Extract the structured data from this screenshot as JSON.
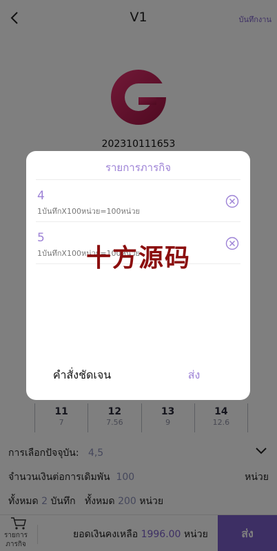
{
  "header": {
    "title": "V1",
    "history_label": "บันทึกงาน"
  },
  "profile": {
    "user_id": "202310111653"
  },
  "numbers": [
    {
      "main": "11",
      "sub": "7"
    },
    {
      "main": "12",
      "sub": "7.56"
    },
    {
      "main": "13",
      "sub": "9"
    },
    {
      "main": "14",
      "sub": "12.6"
    }
  ],
  "info": {
    "current_selection_label": "การเลือกปัจจุบัน:",
    "current_selection_value": "4,5",
    "amount_label": "จำนวนเงินต่อการเดิมพัน",
    "amount_value": "100",
    "amount_unit": "หน่วย",
    "total_label_1": "ทั้งหมด",
    "total_count": "2",
    "total_unit_1": "บันทึก",
    "total_label_2": "ทั้งหมด",
    "total_amount": "200",
    "total_unit_2": "หน่วย"
  },
  "footer": {
    "cart_label": "รายการภารกิจ",
    "balance_label": "ยอดเงินคงเหลือ",
    "balance_value": "1996.00",
    "balance_unit": "หน่วย",
    "submit_label": "ส่ง"
  },
  "modal": {
    "title": "รายการภารกิจ",
    "items": [
      {
        "number": "4",
        "desc": "1บันทึกX100หน่วย=100หน่วย"
      },
      {
        "number": "5",
        "desc": "1บันทึกX100หน่วย=100หน่วย"
      }
    ],
    "clear_label": "คำสั่งชัดเจน",
    "send_label": "ส่ง"
  },
  "watermark": "十方源码",
  "colors": {
    "accent": "#7b5ec9",
    "modal_accent": "#9d82d6",
    "watermark": "#8b0e0e"
  }
}
